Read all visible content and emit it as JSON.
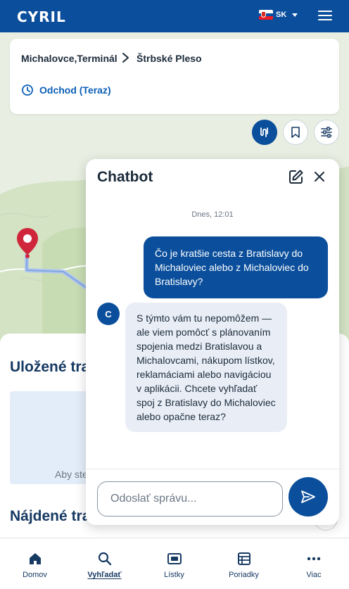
{
  "header": {
    "logo": "CYRIL",
    "language": "SK"
  },
  "route": {
    "from": "Michalovce,Terminál",
    "to": "Štrbské Pleso",
    "departure": "Odchod (Teraz)"
  },
  "background": {
    "saved_title": "Uložené trasy",
    "saved_hint": "Aby ste",
    "found_title": "Nájdené trasy"
  },
  "chat": {
    "title": "Chatbot",
    "date": "Dnes, 12:01",
    "user_message": "Čo je kratšie cesta z Bratislavy do Michaloviec alebo z Michaloviec do Bratislavy?",
    "bot_avatar": "C",
    "bot_message": "S týmto vám tu nepomôžem — ale viem pomôcť s plánovaním spojenia medzi Bratislavou a Michalovcami, nákupom lístkov, reklamáciami alebo navigáciou v aplikácii. Chcete vyhľadať spoj z Bratislavy do Michaloviec alebo opačne teraz?",
    "input_placeholder": "Odoslať správu..."
  },
  "nav": [
    {
      "label": "Domov",
      "icon": "home-icon"
    },
    {
      "label": "Vyhľadať",
      "icon": "search-icon",
      "active": true
    },
    {
      "label": "Lístky",
      "icon": "ticket-icon"
    },
    {
      "label": "Poriadky",
      "icon": "timetable-icon"
    },
    {
      "label": "Viac",
      "icon": "more-icon"
    }
  ],
  "colors": {
    "primary": "#0b4f9c",
    "pin": "#d0263c",
    "map_green": "#cfe0bf"
  }
}
